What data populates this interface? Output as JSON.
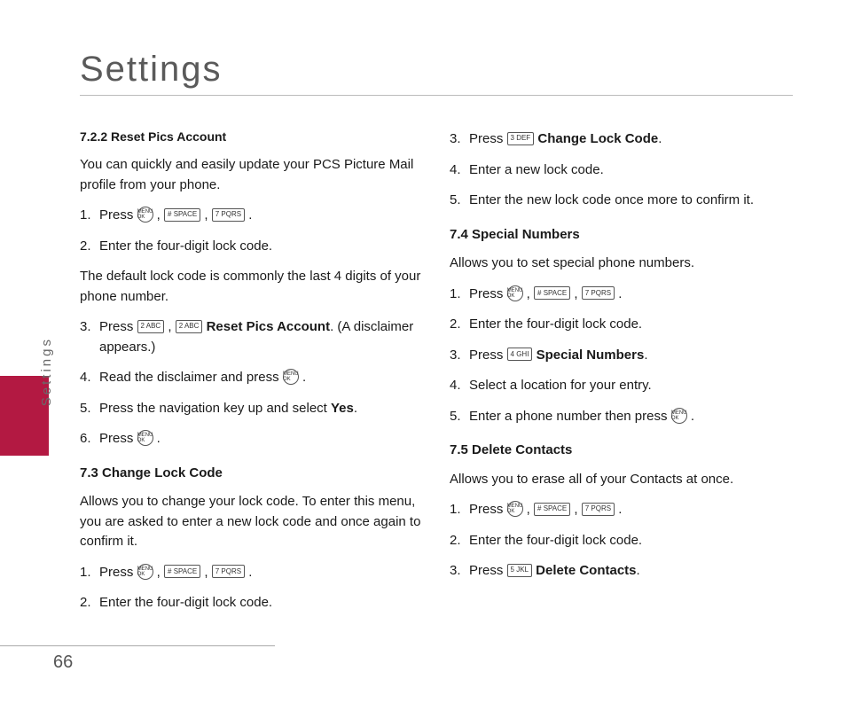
{
  "title": "Settings",
  "sideTab": "Settings",
  "pageNumber": "66",
  "keys": {
    "menuOk": "MENU OK",
    "hash": "# SPACE",
    "k2": "2 ABC",
    "k3": "3 DEF",
    "k4": "4 GHI",
    "k5": "5 JKL",
    "k7": "7 PQRS"
  },
  "left": {
    "s722_head": "7.2.2 Reset Pics Account",
    "s722_intro": "You can quickly and easily update your PCS Picture Mail profile from your phone.",
    "s722_1_a": "Press ",
    "s722_2": "Enter the four-digit lock code.",
    "s722_2_note": "The default lock code is commonly the last 4 digits of your phone number.",
    "s722_3_a": "Press ",
    "s722_3_b": "Reset Pics Account",
    "s722_3_c": ". (A disclaimer appears.)",
    "s722_4_a": "Read the disclaimer and press ",
    "s722_5_a": "Press the navigation key up and select ",
    "s722_5_b": "Yes",
    "s722_6_a": "Press ",
    "s73_head": "7.3 Change Lock Code",
    "s73_intro": "Allows you to change your lock code. To enter this menu, you are asked to enter a new lock code and once again to confirm it.",
    "s73_1_a": "Press ",
    "s73_2": "Enter the four-digit lock code."
  },
  "right": {
    "s73_3_a": "Press ",
    "s73_3_b": "Change Lock Code",
    "s73_4": "Enter a new lock code.",
    "s73_5": "Enter the new lock code once more to confirm it.",
    "s74_head": "7.4 Special Numbers",
    "s74_intro": "Allows you to set special phone numbers.",
    "s74_1_a": "Press ",
    "s74_2": "Enter the four-digit lock code.",
    "s74_3_a": "Press ",
    "s74_3_b": "Special Numbers",
    "s74_4": "Select a location for your entry.",
    "s74_5_a": "Enter a phone number then press ",
    "s75_head": "7.5 Delete Contacts",
    "s75_intro": "Allows you to erase all of your Contacts at once.",
    "s75_1_a": "Press ",
    "s75_2": "Enter the four-digit lock code.",
    "s75_3_a": "Press ",
    "s75_3_b": "Delete Contacts"
  }
}
